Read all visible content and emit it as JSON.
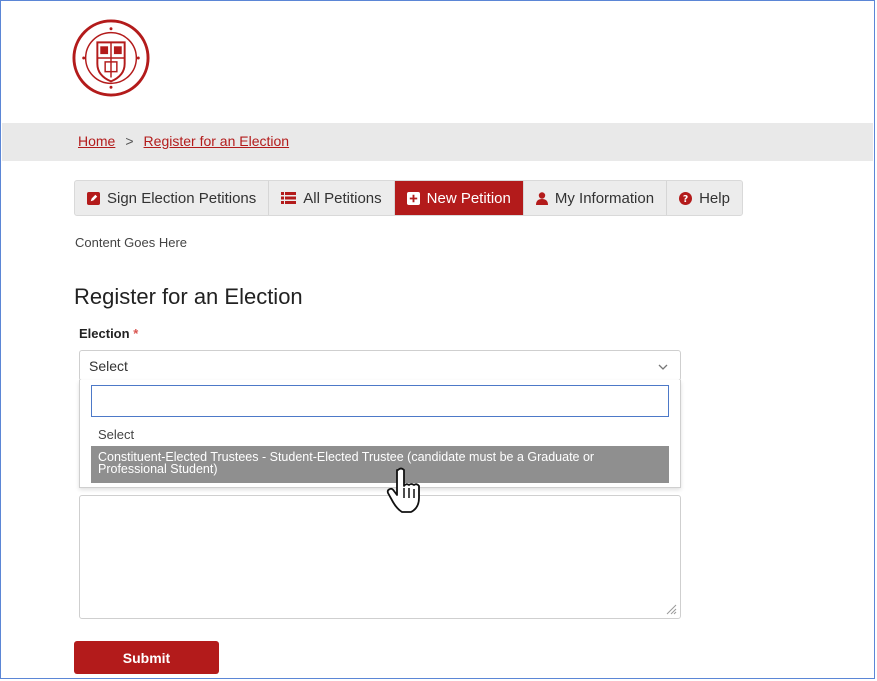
{
  "breadcrumb": {
    "home": "Home",
    "separator": ">",
    "current": "Register for an Election"
  },
  "tabs": [
    {
      "label": "Sign Election Petitions",
      "icon": "pencil-square-icon",
      "active": false
    },
    {
      "label": "All Petitions",
      "icon": "list-icon",
      "active": false
    },
    {
      "label": "New Petition",
      "icon": "plus-square-icon",
      "active": true
    },
    {
      "label": "My Information",
      "icon": "user-icon",
      "active": false
    },
    {
      "label": "Help",
      "icon": "question-circle-icon",
      "active": false
    }
  ],
  "content_text": "Content Goes Here",
  "page_title": "Register for an Election",
  "form": {
    "election_label": "Election",
    "required_mark": "*",
    "select_value": "Select",
    "search_value": "",
    "options": [
      "Select",
      "Constituent-Elected Trustees - Student-Elected Trustee (candidate must be a Graduate or Professional Student)"
    ],
    "highlighted_option": 1,
    "submit_label": "Submit"
  },
  "colors": {
    "brand_red": "#b31b1b",
    "highlight_gray": "#8f8f8f",
    "breadcrumb_bar": "#e9e9e9"
  }
}
